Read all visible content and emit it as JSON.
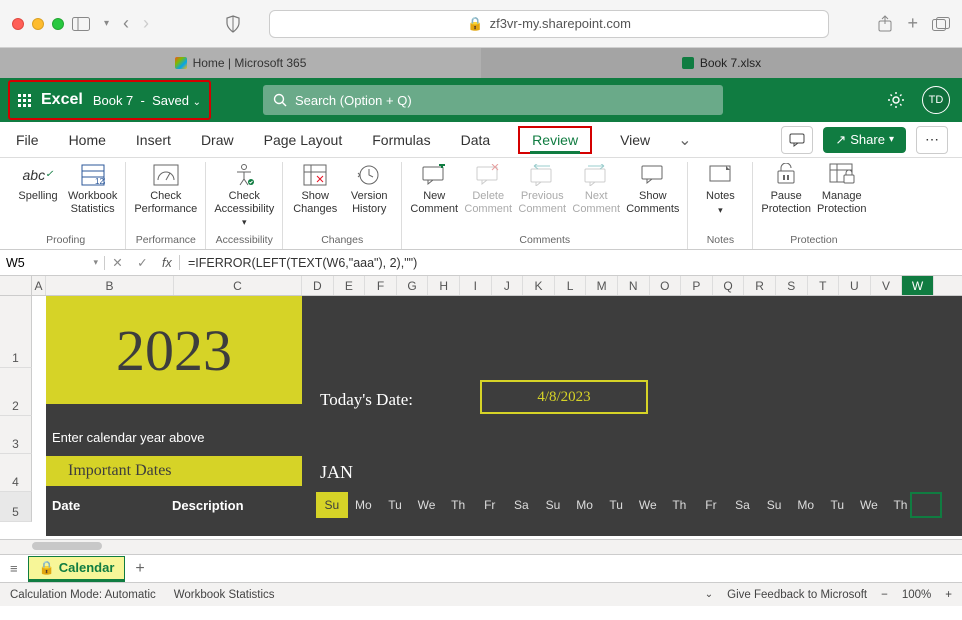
{
  "browser": {
    "url_host": "zf3vr-my.sharepoint.com",
    "tabs": [
      {
        "label": "Home | Microsoft 365"
      },
      {
        "label": "Book 7.xlsx"
      }
    ]
  },
  "titlebar": {
    "app_name": "Excel",
    "file_name": "Book 7",
    "save_state": "Saved",
    "search_placeholder": "Search (Option + Q)",
    "avatar_initials": "TD"
  },
  "ribbon_tabs": {
    "file": "File",
    "home": "Home",
    "insert": "Insert",
    "draw": "Draw",
    "page_layout": "Page Layout",
    "formulas": "Formulas",
    "data": "Data",
    "review": "Review",
    "view": "View",
    "share": "Share"
  },
  "ribbon": {
    "groups": {
      "proofing": {
        "label": "Proofing",
        "spelling": "Spelling",
        "workbook_stats": "Workbook\nStatistics"
      },
      "performance": {
        "label": "Performance",
        "check_perf": "Check\nPerformance"
      },
      "accessibility": {
        "label": "Accessibility",
        "check_access": "Check\nAccessibility"
      },
      "changes": {
        "label": "Changes",
        "show_changes": "Show\nChanges",
        "version_history": "Version\nHistory"
      },
      "comments": {
        "label": "Comments",
        "new_comment": "New\nComment",
        "delete_comment": "Delete\nComment",
        "previous_comment": "Previous\nComment",
        "next_comment": "Next\nComment",
        "show_comments": "Show\nComments"
      },
      "notes": {
        "label": "Notes",
        "notes": "Notes"
      },
      "protection": {
        "label": "Protection",
        "pause_protection": "Pause\nProtection",
        "manage_protection": "Manage\nProtection"
      }
    }
  },
  "formula_bar": {
    "cell_ref": "W5",
    "formula": "=IFERROR(LEFT(TEXT(W6,\"aaa\"), 2),\"\")"
  },
  "columns": [
    "A",
    "B",
    "C",
    "D",
    "E",
    "F",
    "G",
    "H",
    "I",
    "J",
    "K",
    "L",
    "M",
    "N",
    "O",
    "P",
    "Q",
    "R",
    "S",
    "T",
    "U",
    "V",
    "W"
  ],
  "rows": [
    "1",
    "2",
    "3",
    "4",
    "5"
  ],
  "selected_col": "W",
  "calendar": {
    "year": "2023",
    "todays_date_label": "Today's Date:",
    "todays_date": "4/8/2023",
    "enter_year_hint": "Enter calendar year above",
    "important_dates_label": "Important Dates",
    "month_label": "JAN",
    "date_header": "Date",
    "description_header": "Description",
    "dow": [
      "Su",
      "Mo",
      "Tu",
      "We",
      "Th",
      "Fr",
      "Sa",
      "Su",
      "Mo",
      "Tu",
      "We",
      "Th",
      "Fr",
      "Sa",
      "Su",
      "Mo",
      "Tu",
      "We",
      "Th"
    ]
  },
  "sheet_tab": {
    "name": "Calendar"
  },
  "statusbar": {
    "calc_mode": "Calculation Mode: Automatic",
    "workbook_stats": "Workbook Statistics",
    "feedback": "Give Feedback to Microsoft",
    "zoom": "100%"
  }
}
